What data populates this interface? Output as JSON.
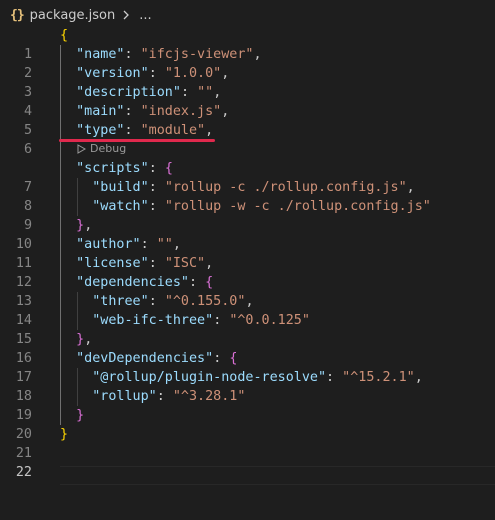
{
  "breadcrumb": {
    "icon_glyph": "{}",
    "filename": "package.json",
    "more": "..."
  },
  "codelens": {
    "label": "Debug",
    "icon": "play-triangle-outline-icon"
  },
  "line_numbers": [
    "1",
    "2",
    "3",
    "4",
    "5",
    "6",
    "7",
    "8",
    "9",
    "10",
    "11",
    "12",
    "13",
    "14",
    "15",
    "16",
    "17",
    "18",
    "19",
    "20",
    "21",
    "22"
  ],
  "code": {
    "l2_key": "\"name\"",
    "l2_val": "\"ifcjs-viewer\"",
    "l3_key": "\"version\"",
    "l3_val": "\"1.0.0\"",
    "l4_key": "\"description\"",
    "l4_val": "\"\"",
    "l5_key": "\"main\"",
    "l5_val": "\"index.js\"",
    "l6_key": "\"type\"",
    "l6_val": "\"module\"",
    "l7_key": "\"scripts\"",
    "l8_key": "\"build\"",
    "l8_val": "\"rollup -c ./rollup.config.js\"",
    "l9_key": "\"watch\"",
    "l9_val": "\"rollup -w -c ./rollup.config.js\"",
    "l11_key": "\"author\"",
    "l11_val": "\"\"",
    "l12_key": "\"license\"",
    "l12_val": "\"ISC\"",
    "l13_key": "\"dependencies\"",
    "l14_key": "\"three\"",
    "l14_val": "\"^0.155.0\"",
    "l15_key": "\"web-ifc-three\"",
    "l15_val": "\"^0.0.125\"",
    "l17_key": "\"devDependencies\"",
    "l18_key": "\"@rollup/plugin-node-resolve\"",
    "l18_val": "\"^15.2.1\"",
    "l19_key": "\"rollup\"",
    "l19_val": "\"^3.28.1\""
  },
  "colors": {
    "background": "#1e1e1e",
    "key": "#9cdcfe",
    "string": "#ce9178",
    "bracket_level1": "#ffd700",
    "bracket_level2": "#da70d6",
    "bracket_level3": "#179fff",
    "annotation_underline": "#e0294d"
  }
}
